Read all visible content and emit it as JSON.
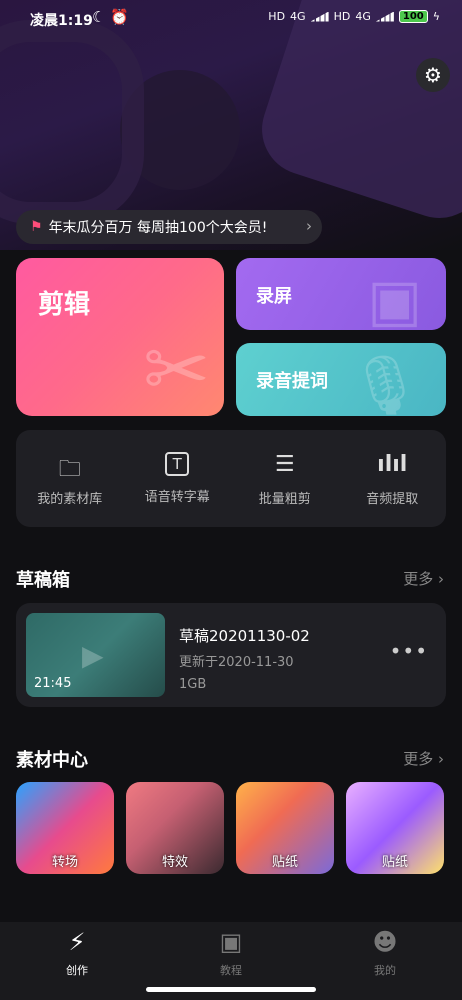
{
  "status_bar": {
    "time": "凌晨1:19",
    "left_icons": "☾ ⏰",
    "hd1": "HD",
    "net1": "4G",
    "hd2": "HD",
    "net2": "4G",
    "battery": "100"
  },
  "promo": {
    "text": "年末瓜分百万 每周抽100个大会员!"
  },
  "cards": {
    "edit": "剪辑",
    "record": "录屏",
    "voice": "录音提词"
  },
  "tools": [
    {
      "icon": "folder-icon",
      "glyph": "🗀",
      "label": "我的素材库"
    },
    {
      "icon": "text-recognition-icon",
      "glyph": "T",
      "label": "语音转字幕"
    },
    {
      "icon": "list-icon",
      "glyph": "☰",
      "label": "批量粗剪"
    },
    {
      "icon": "waveform-icon",
      "glyph": "ılıl",
      "label": "音频提取"
    }
  ],
  "drafts": {
    "title": "草稿箱",
    "more": "更多",
    "item": {
      "name": "草稿20201130-02",
      "updated": "更新于2020-11-30",
      "size": "1GB",
      "duration": "21:45"
    }
  },
  "materials": {
    "title": "素材中心",
    "more": "更多",
    "items": [
      {
        "label": "转场"
      },
      {
        "label": "特效"
      },
      {
        "label": "贴纸"
      },
      {
        "label": "贴纸"
      }
    ]
  },
  "tabs": [
    {
      "label": "创作",
      "icon": "lightning-icon",
      "active": true
    },
    {
      "label": "教程",
      "icon": "play-book-icon",
      "active": false
    },
    {
      "label": "我的",
      "icon": "user-icon",
      "active": false
    }
  ]
}
